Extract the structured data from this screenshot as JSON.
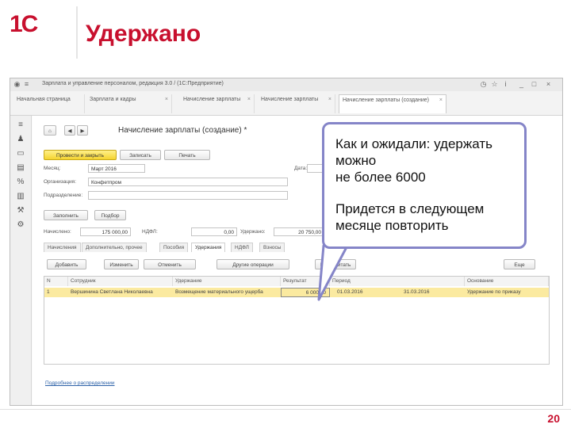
{
  "slide": {
    "logo": "1С",
    "title": "Удержано",
    "page_number": "20",
    "brand_color": "#c8102e"
  },
  "window": {
    "title": "Зарплата и управление персоналом, редакция 3.0 / (1С:Предприятие)",
    "tabs": [
      {
        "label": "Начальная страница"
      },
      {
        "label": "Зарплата и кадры"
      },
      {
        "label": "Начисление зарплаты"
      },
      {
        "label": "Начисление зарплаты"
      },
      {
        "label": "Начисление зарплаты (создание)"
      }
    ]
  },
  "form": {
    "heading": "Начисление зарплаты (создание) *",
    "buttons": {
      "post_close": "Провести и закрыть",
      "save": "Записать",
      "print": "Печать",
      "fill": "Заполнить",
      "pick": "Подбор"
    },
    "fields": {
      "month_label": "Месяц:",
      "month_value": "Март 2016",
      "date_label": "Дата:",
      "org_label": "Организация:",
      "org_value": "Конфетпром",
      "dept_label": "Подразделение:",
      "accrued_label": "Начислено:",
      "accrued_value": "175 000,00",
      "deducted_label": "Удержано:",
      "deducted_value": "20 750,00",
      "ndfl_label": "НДФЛ:",
      "ndfl_value": "0,00"
    },
    "tabs": [
      "Начисления",
      "Дополнительно, прочее",
      "Пособия",
      "Удержания",
      "НДФЛ",
      "Взносы"
    ],
    "active_tab": "Удержания",
    "table_toolbar": {
      "add": "Добавить",
      "edit": "Изменить",
      "cancel": "Отменить",
      "other": "Другие операции",
      "recalc": "Пересчитать",
      "more": "Еще"
    },
    "columns": [
      "N",
      "Сотрудник",
      "Удержание",
      "Результат",
      "Период",
      "Основание"
    ],
    "rows": [
      {
        "n": "1",
        "employee": "Вершинина Светлана Николаевна",
        "deduction": "Возмещение материального ущерба",
        "result": "6 000,00",
        "period": "01.03.2016",
        "period_end": "31.03.2016",
        "basis": "Удержание по приказу"
      }
    ],
    "footer_link": "Подробнее о распределении"
  },
  "callout": {
    "line1": "Как и ожидали: удержать",
    "line2": "можно",
    "line3": "не более 6000",
    "line4": "Придется в следующем",
    "line5": "месяце повторить",
    "border_color": "#8585c8"
  }
}
